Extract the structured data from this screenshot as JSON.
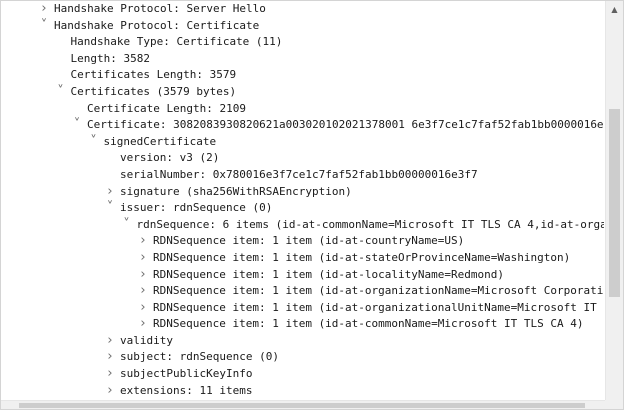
{
  "icons": {
    "collapsed": "chevron-right-icon",
    "expanded": "chevron-down-icon",
    "scroll_up": "scroll-up-arrow-icon"
  },
  "colors": {
    "text": "#1a1a1a",
    "arrow": "#6e6e6e",
    "scrollbar_track": "#f0f0f0",
    "scrollbar_thumb": "#cdcdcd"
  },
  "tree": {
    "rows": [
      {
        "depth": 0,
        "state": "collapsed",
        "label": "Handshake Protocol: Server Hello"
      },
      {
        "depth": 0,
        "state": "expanded",
        "label": "Handshake Protocol: Certificate"
      },
      {
        "depth": 1,
        "state": "leaf",
        "label": "Handshake Type: Certificate (11)"
      },
      {
        "depth": 1,
        "state": "leaf",
        "label": "Length: 3582"
      },
      {
        "depth": 1,
        "state": "leaf",
        "label": "Certificates Length: 3579"
      },
      {
        "depth": 1,
        "state": "expanded",
        "label": "Certificates (3579 bytes)"
      },
      {
        "depth": 2,
        "state": "leaf",
        "label": "Certificate Length: 2109"
      },
      {
        "depth": 2,
        "state": "expanded",
        "label": "Certificate: 3082083930820621a003020102021378001 6e3f7ce1c7faf52fab1bb0000016e"
      },
      {
        "depth": 3,
        "state": "expanded",
        "label": "signedCertificate"
      },
      {
        "depth": 4,
        "state": "leaf",
        "label": "version: v3 (2)"
      },
      {
        "depth": 4,
        "state": "leaf",
        "label": "serialNumber: 0x780016e3f7ce1c7faf52fab1bb00000016e3f7"
      },
      {
        "depth": 4,
        "state": "collapsed",
        "label": "signature (sha256WithRSAEncryption)"
      },
      {
        "depth": 4,
        "state": "expanded",
        "label": "issuer: rdnSequence (0)"
      },
      {
        "depth": 5,
        "state": "expanded",
        "label": "rdnSequence: 6 items (id-at-commonName=Microsoft IT TLS CA 4,id-at-organ"
      },
      {
        "depth": 6,
        "state": "collapsed",
        "label": "RDNSequence item: 1 item (id-at-countryName=US)"
      },
      {
        "depth": 6,
        "state": "collapsed",
        "label": "RDNSequence item: 1 item (id-at-stateOrProvinceName=Washington)"
      },
      {
        "depth": 6,
        "state": "collapsed",
        "label": "RDNSequence item: 1 item (id-at-localityName=Redmond)"
      },
      {
        "depth": 6,
        "state": "collapsed",
        "label": "RDNSequence item: 1 item (id-at-organizationName=Microsoft Corporatio"
      },
      {
        "depth": 6,
        "state": "collapsed",
        "label": "RDNSequence item: 1 item (id-at-organizationalUnitName=Microsoft IT"
      },
      {
        "depth": 6,
        "state": "collapsed",
        "label": "RDNSequence item: 1 item (id-at-commonName=Microsoft IT TLS CA 4)"
      },
      {
        "depth": 4,
        "state": "collapsed",
        "label": "validity"
      },
      {
        "depth": 4,
        "state": "collapsed",
        "label": "subject: rdnSequence (0)"
      },
      {
        "depth": 4,
        "state": "collapsed",
        "label": "subjectPublicKeyInfo"
      },
      {
        "depth": 4,
        "state": "collapsed",
        "label": "extensions: 11 items"
      }
    ]
  }
}
